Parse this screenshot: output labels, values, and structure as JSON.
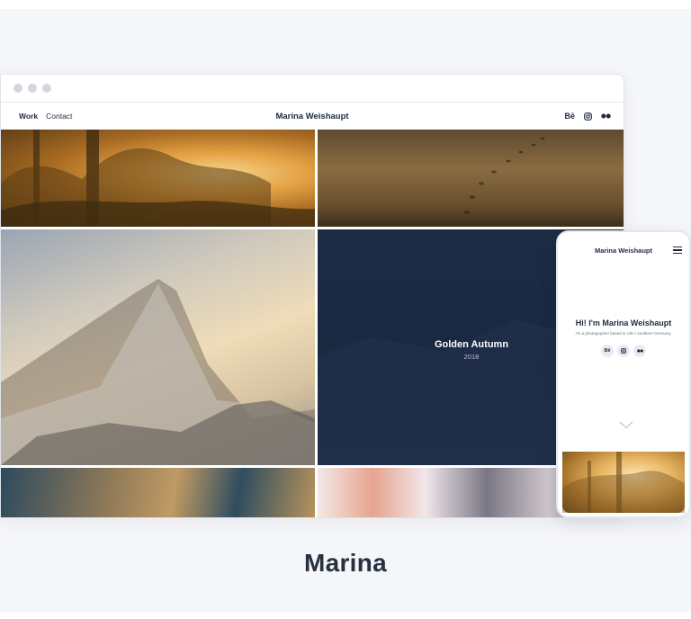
{
  "site": {
    "nav": {
      "work_label": "Work",
      "contact_label": "Contact"
    },
    "title": "Marina Weishaupt",
    "social": {
      "behance": "Bē",
      "instagram": "instagram-icon",
      "flickr": "flickr-icon"
    }
  },
  "gallery": {
    "featured": {
      "title": "Golden Autumn",
      "year": "2018"
    }
  },
  "mobile": {
    "title": "Marina Weishaupt",
    "hero_title": "Hi! I'm Marina Weishaupt",
    "hero_subtitle": "I'm a photographer based in Ulm / southern Germany.",
    "social": {
      "behance": "Bē"
    }
  },
  "caption": "Marina",
  "colors": {
    "navy": "#1e2a44",
    "panel": "#f5f6f9",
    "featured_bg": "#1d2b45"
  }
}
